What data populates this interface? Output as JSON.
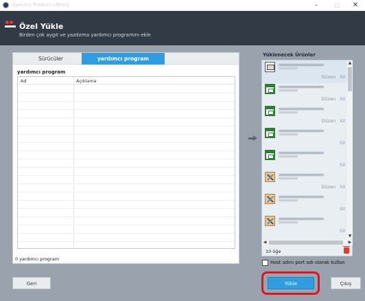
{
  "window": {
    "title": "Kyocera Product Library",
    "controls": {
      "minimize": "–",
      "maximize": "□",
      "close": "✕"
    }
  },
  "header": {
    "title": "Özel Yükle",
    "subtitle": "Birden çok aygıt ve yazdırma yardımcı programını ekle"
  },
  "tabs": [
    {
      "label": "Sürücüler",
      "active": false
    },
    {
      "label": "yardımcı program",
      "active": true
    }
  ],
  "left": {
    "section_title": "yardımcı program",
    "columns": [
      "Ad",
      "Açıklama"
    ],
    "footer": "0 yardımcı program"
  },
  "right": {
    "title": "Yüklenecek Ürünler",
    "items": [
      {
        "icon": "printer-icon",
        "actions": [
          "Düzen",
          "Sil"
        ]
      },
      {
        "icon": "window-icon",
        "actions": [
          "Düzen",
          "Sil"
        ]
      },
      {
        "icon": "window-icon",
        "actions": [
          "Düzen",
          "Sil"
        ]
      },
      {
        "icon": "window-icon",
        "actions": [
          "Sil"
        ]
      },
      {
        "icon": "window-icon",
        "actions": [
          "Sil"
        ]
      },
      {
        "icon": "tools-icon",
        "actions": [
          "Düzen",
          "Sil"
        ]
      },
      {
        "icon": "tools-icon",
        "actions": [
          "Sil"
        ]
      },
      {
        "icon": "tools-icon",
        "actions": [
          "Sil"
        ]
      }
    ],
    "count": "10 öğe"
  },
  "options": {
    "host_checkbox_label": "Host adını port adı olarak kullan",
    "host_checked": false
  },
  "buttons": {
    "back": "Geri",
    "install": "Yükle",
    "exit": "Çıkış"
  },
  "colors": {
    "header_bg": "#323a45",
    "accent": "#2f9ddf",
    "highlight": "#e0141e",
    "body_bg": "#9aa3ad"
  }
}
